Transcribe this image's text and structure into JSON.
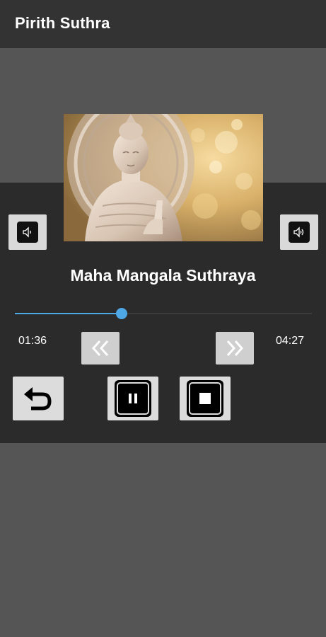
{
  "app_bar": {
    "title": "Pirith Suthra"
  },
  "player": {
    "artwork_icon": "buddha-statue-image",
    "track_title": "Maha Mangala Suthraya",
    "elapsed": "01:36",
    "total": "04:27",
    "progress_fraction": 0.36,
    "seek_color": "#4fa8e6"
  },
  "controls": {
    "volume_down_icon": "volume-down-icon",
    "volume_up_icon": "volume-up-icon",
    "rewind_icon": "double-chevron-left-icon",
    "fast_forward_icon": "double-chevron-right-icon",
    "repeat_icon": "undo-arrow-icon",
    "pause_icon": "pause-icon",
    "stop_icon": "stop-icon"
  }
}
